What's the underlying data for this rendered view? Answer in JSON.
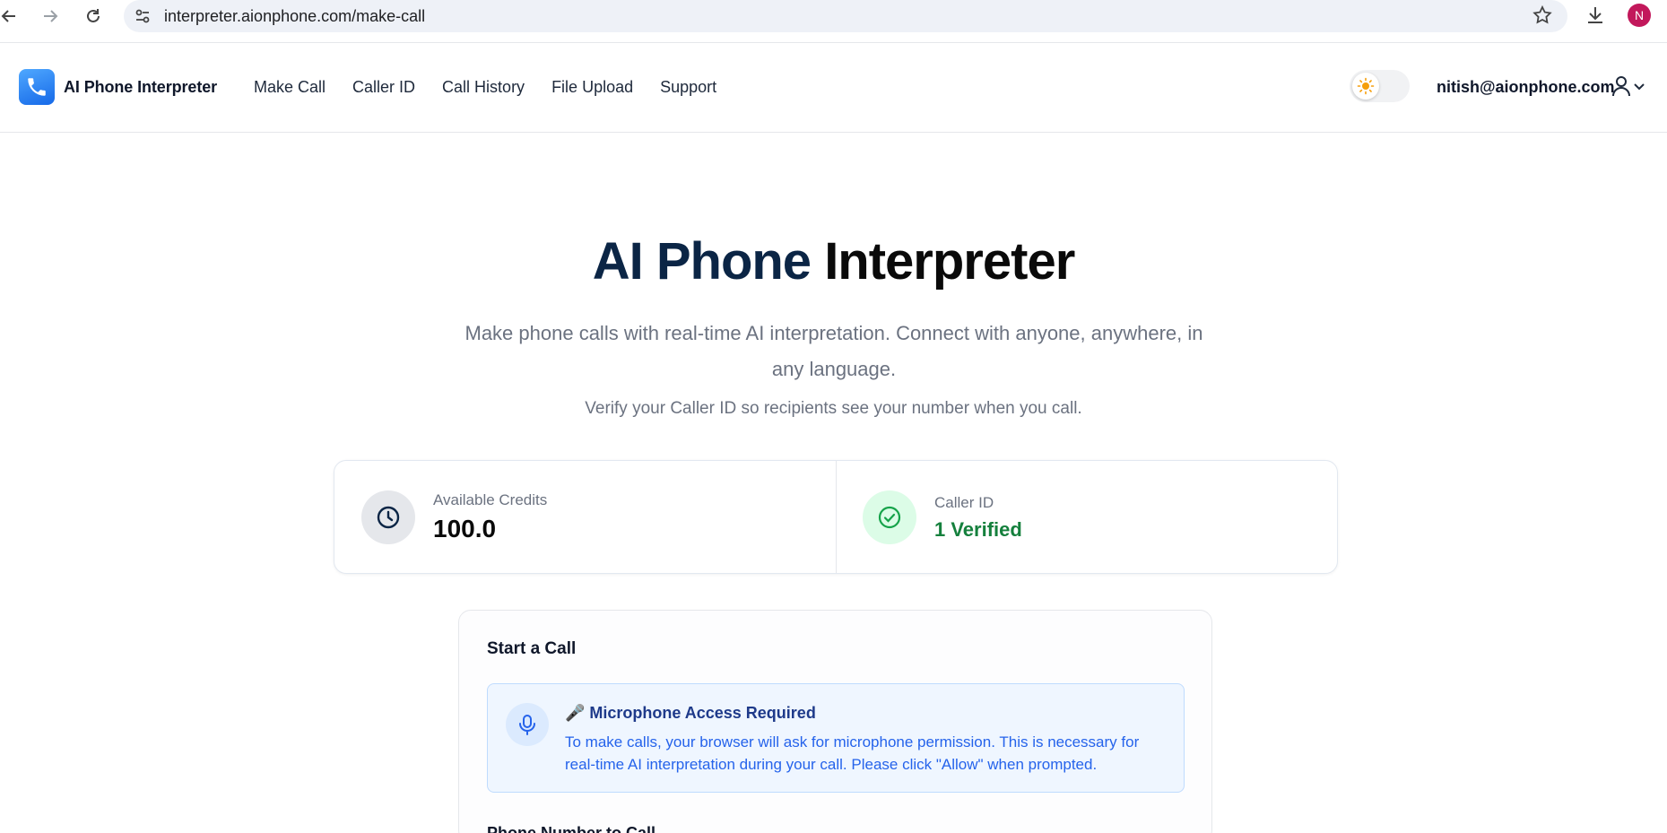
{
  "browser": {
    "url": "interpreter.aionphone.com/make-call",
    "profile_initial": "N"
  },
  "header": {
    "brand": "AI Phone Interpreter",
    "nav": [
      "Make Call",
      "Caller ID",
      "Call History",
      "File Upload",
      "Support"
    ],
    "user_email": "nitish@aionphone.com",
    "theme": "light"
  },
  "hero": {
    "title_part1": "AI Phone",
    "title_part2": "Interpreter",
    "subtitle": "Make phone calls with real-time AI interpretation. Connect with anyone, anywhere, in any language.",
    "note": "Verify your Caller ID so recipients see your number when you call."
  },
  "stats": {
    "credits_label": "Available Credits",
    "credits_value": "100.0",
    "callerid_label": "Caller ID",
    "callerid_value": "1 Verified"
  },
  "call": {
    "title": "Start a Call",
    "mic_heading": "🎤 Microphone Access Required",
    "mic_text": "To make calls, your browser will ask for microphone permission. This is necessary for real-time AI interpretation during your call. Please click \"Allow\" when prompted.",
    "phone_label": "Phone Number to Call"
  },
  "colors": {
    "accent_navy": "#0b2545",
    "verified_green": "#15803d",
    "info_blue": "#2563eb",
    "sun_icon": "#f59e0b"
  }
}
